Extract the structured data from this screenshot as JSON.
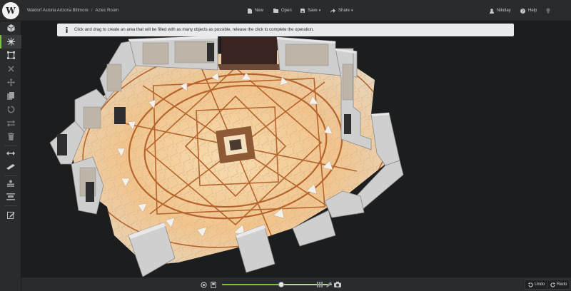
{
  "app": {
    "logo_letter": "W"
  },
  "breadcrumb": {
    "project": "Waldorf Astoria Arizona Biltmore",
    "separator": "/",
    "room": "Aztec Room"
  },
  "toolbar": {
    "new_label": "New",
    "open_label": "Open",
    "save_label": "Save",
    "share_label": "Share",
    "user_label": "Nikolay",
    "help_label": "Help"
  },
  "banner": {
    "message": "Click and drag to create an area that will be filled with as many objects as possible, release the click to complete the operation."
  },
  "zoom": {
    "level": 0.54
  },
  "actions": {
    "undo_label": "Undo",
    "redo_label": "Redo"
  },
  "sidebar": {
    "tools": [
      {
        "icon": "cube-icon",
        "active": false
      },
      {
        "icon": "fill-area-icon",
        "active": true
      },
      {
        "icon": "select-frame-icon",
        "active": false
      },
      {
        "icon": "delete-x-icon",
        "active": false
      },
      {
        "icon": "move-arrows-icon",
        "active": false
      },
      {
        "icon": "copy-icon",
        "active": false
      },
      {
        "icon": "rotate-icon",
        "active": false
      },
      {
        "icon": "swap-icon",
        "active": false
      },
      {
        "icon": "trash-icon",
        "active": false
      },
      {
        "icon": "distribute-horizontal-icon",
        "active": false
      },
      {
        "icon": "measure-ruler-icon",
        "active": false
      },
      {
        "icon": "group-icon",
        "active": false
      },
      {
        "icon": "align-icon",
        "active": false
      },
      {
        "icon": "edit-notes-icon",
        "active": false
      }
    ]
  },
  "colors": {
    "accent": "#7fc43a",
    "floor_wood": "#b5652d",
    "floor_light": "#f6d6a6",
    "wall": "#d4d4d4"
  }
}
